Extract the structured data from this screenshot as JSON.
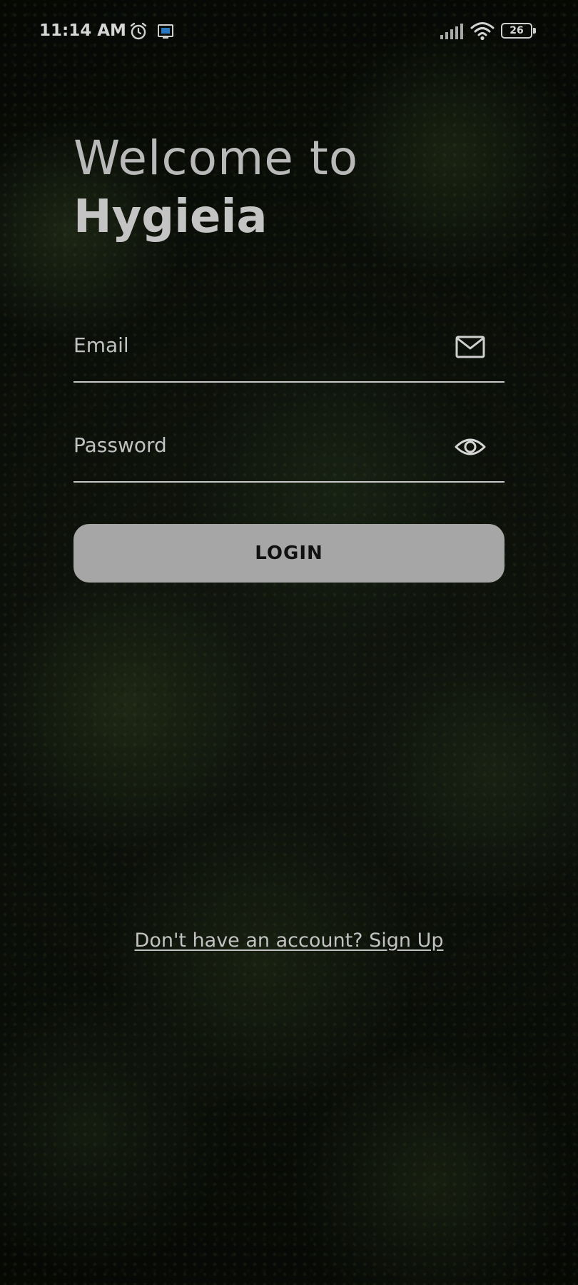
{
  "status_bar": {
    "time": "11:14 AM",
    "battery_level": "26",
    "icons": [
      "alarm-icon",
      "screen-cast-icon",
      "signal-icon",
      "wifi-icon",
      "battery-icon"
    ]
  },
  "heading": {
    "line1": "Welcome to",
    "line2": "Hygieia"
  },
  "form": {
    "email": {
      "value": "",
      "placeholder": "Email",
      "icon": "mail-icon"
    },
    "password": {
      "value": "",
      "placeholder": "Password",
      "icon": "eye-icon"
    },
    "login_label": "LOGIN"
  },
  "footer": {
    "signup_link": "Don't have an account? Sign Up"
  },
  "colors": {
    "button_bg": "#a6a6a6",
    "button_text": "#111111",
    "text_light": "#c2c2c2"
  }
}
